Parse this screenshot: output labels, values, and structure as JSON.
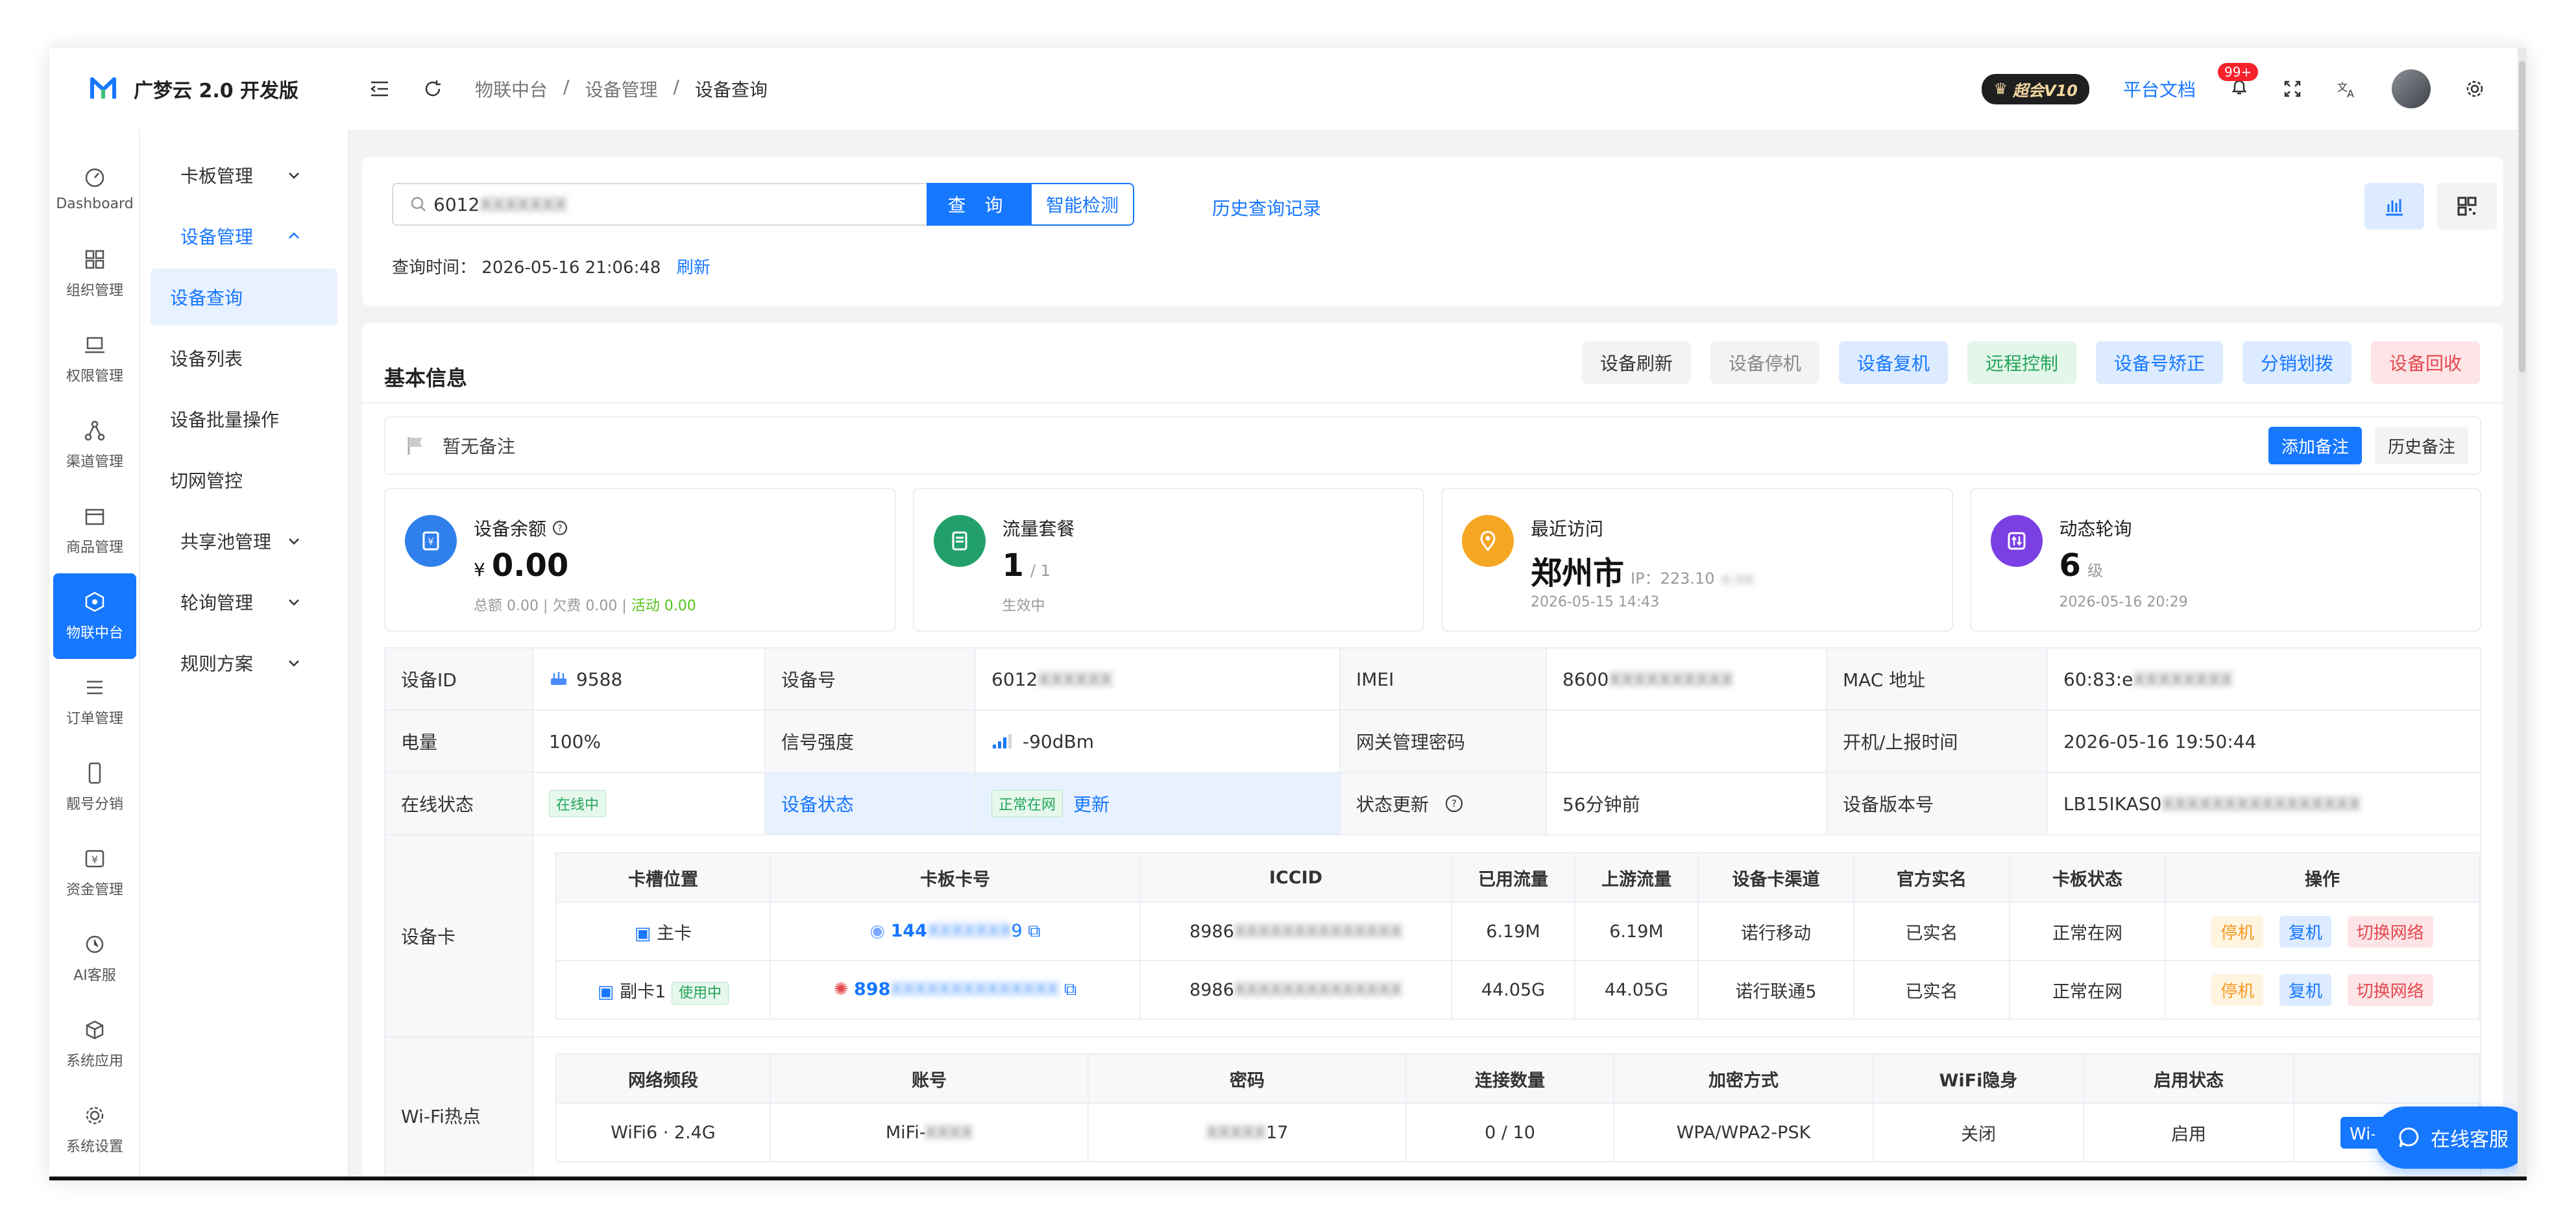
{
  "app": {
    "title": "广梦云 2.0 开发版"
  },
  "rail": [
    {
      "label": "Dashboard",
      "icon": "dashboard-icon"
    },
    {
      "label": "组织管理",
      "icon": "grid-icon"
    },
    {
      "label": "权限管理",
      "icon": "laptop-icon"
    },
    {
      "label": "渠道管理",
      "icon": "share-icon"
    },
    {
      "label": "商品管理",
      "icon": "store-icon"
    },
    {
      "label": "物联中台",
      "icon": "cube-icon"
    },
    {
      "label": "订单管理",
      "icon": "list-icon"
    },
    {
      "label": "靓号分销",
      "icon": "phone-icon"
    },
    {
      "label": "资金管理",
      "icon": "wallet-icon"
    },
    {
      "label": "AI客服",
      "icon": "chat-icon"
    },
    {
      "label": "系统应用",
      "icon": "box-icon"
    },
    {
      "label": "系统设置",
      "icon": "gear-icon"
    }
  ],
  "sidebar": [
    {
      "label": "卡板管理"
    },
    {
      "label": "设备管理"
    },
    {
      "label": "设备查询"
    },
    {
      "label": "设备列表"
    },
    {
      "label": "设备批量操作"
    },
    {
      "label": "切网管控"
    },
    {
      "label": "共享池管理"
    },
    {
      "label": "轮询管理"
    },
    {
      "label": "规则方案"
    }
  ],
  "breadcrumb": [
    "物联中台",
    "/",
    "设备管理",
    "/",
    "设备查询"
  ],
  "topbar": {
    "vip": "超会V10",
    "docs": "平台文档",
    "notif_count": "99+"
  },
  "search": {
    "value_prefix": "6012",
    "value_blur": "XXXXXXX",
    "query_button": "查 询",
    "smart_button": "智能检测",
    "history_link": "历史查询记录",
    "time_label": "查询时间：",
    "time_value": "2026-05-16 21:06:48",
    "refresh": "刷新"
  },
  "basic": {
    "title": "基本信息",
    "actions": [
      {
        "label": "设备刷新",
        "bg": "#f2f3f5",
        "fg": "#333333"
      },
      {
        "label": "设备停机",
        "bg": "#f2f3f5",
        "fg": "#888888"
      },
      {
        "label": "设备复机",
        "bg": "#dcebff",
        "fg": "#1677ff"
      },
      {
        "label": "远程控制",
        "bg": "#e3f6ea",
        "fg": "#23a55a"
      },
      {
        "label": "设备号矫正",
        "bg": "#dcebff",
        "fg": "#1677ff"
      },
      {
        "label": "分销划拨",
        "bg": "#dcebff",
        "fg": "#1677ff"
      },
      {
        "label": "设备回收",
        "bg": "#fde4e6",
        "fg": "#e5484d"
      }
    ],
    "remark": "暂无备注",
    "add_remark": "添加备注",
    "remark_history": "历史备注"
  },
  "stats": [
    {
      "label": "设备余额",
      "currency": "¥",
      "value": "0.00",
      "sub1": "总额 0.00",
      "sub2": "欠费 0.00",
      "sub3": "活动 0.00",
      "color": "#2f80ed"
    },
    {
      "label": "流量套餐",
      "value": "1",
      "unit": "/ 1",
      "sub1": "生效中",
      "color": "#22a06b"
    },
    {
      "label": "最近访问",
      "value": "郑州市",
      "unit": "IP：223.10",
      "sub1": "2026-05-15 14:43",
      "color": "#f5a623"
    },
    {
      "label": "动态轮询",
      "value": "6",
      "unit": "级",
      "sub1": "2026-05-16 20:29",
      "color": "#7b3fe4"
    }
  ],
  "details": {
    "r1": {
      "l1": "设备ID",
      "v1": "9588",
      "l2": "设备号",
      "v2": "6012",
      "l3": "IMEI",
      "v3": "8600",
      "l4": "MAC 地址",
      "v4": "60:83:e"
    },
    "r2": {
      "l1": "电量",
      "v1": "100%",
      "l2": "信号强度",
      "v2": "-90dBm",
      "l3": "网关管理密码",
      "v3": "",
      "l4": "开机/上报时间",
      "v4": "2026-05-16 19:50:44"
    },
    "r3": {
      "l1": "在线状态",
      "v1": "在线中",
      "l2": "设备状态",
      "v2": "正常在网",
      "v2b": "更新",
      "l3": "状态更新",
      "v3": "56分钟前",
      "l4": "设备版本号",
      "v4": "LB15IKAS0"
    }
  },
  "card_table": {
    "section": "设备卡",
    "headers": [
      "卡槽位置",
      "卡板卡号",
      "ICCID",
      "已用流量",
      "上游流量",
      "设备卡渠道",
      "官方实名",
      "卡板状态",
      "操作"
    ],
    "rows": [
      {
        "slot": "主卡",
        "tag": "",
        "card": "144",
        "card_end": "9",
        "iccid": "8986",
        "used": "6.19M",
        "up": "6.19M",
        "channel": "诺行移动",
        "real": "已实名",
        "state": "正常在网"
      },
      {
        "slot": "副卡1",
        "tag": "使用中",
        "card": "898",
        "card_end": "",
        "iccid": "8986",
        "used": "44.05G",
        "up": "44.05G",
        "channel": "诺行联通5",
        "real": "已实名",
        "state": "正常在网"
      }
    ],
    "ops": [
      "停机",
      "复机",
      "切换网络"
    ]
  },
  "wifi_table": {
    "section": "Wi-Fi热点",
    "headers": [
      "网络频段",
      "账号",
      "密码",
      "连接数量",
      "加密方式",
      "WiFi隐身",
      "启用状态"
    ],
    "row": {
      "band": "WiFi6 · 2.4G",
      "ssid": "MiFi-",
      "pwd": "17",
      "conn": "0 / 10",
      "enc": "WPA/WPA2-PSK",
      "hidden": "关闭",
      "enabled": "启用"
    },
    "button": "Wi-Fi设置"
  },
  "float": {
    "label": "在线客服"
  },
  "colors": {
    "accent": "#1677ff",
    "rail_active": "#1677ff"
  }
}
